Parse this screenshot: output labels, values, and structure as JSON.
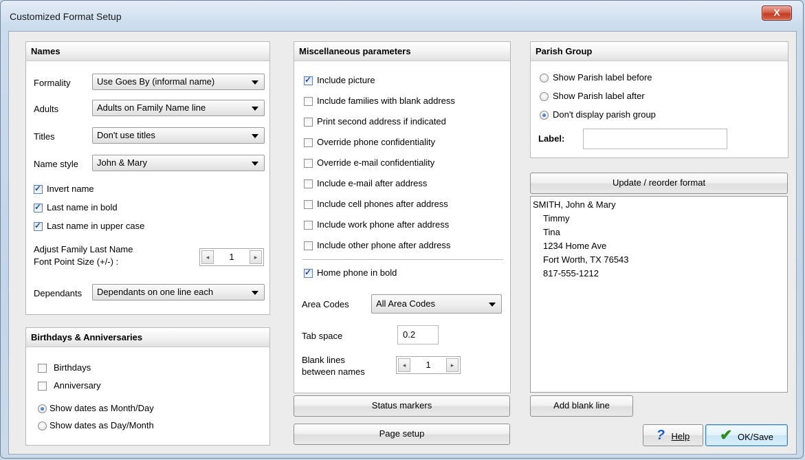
{
  "window": {
    "title": "Customized Format Setup",
    "close_glyph": "X"
  },
  "names": {
    "header": "Names",
    "formality_label": "Formality",
    "formality_value": "Use Goes By (informal name)",
    "adults_label": "Adults",
    "adults_value": "Adults on Family Name line",
    "titles_label": "Titles",
    "titles_value": "Don't use titles",
    "namestyle_label": "Name style",
    "namestyle_value": "John & Mary",
    "invert_name": "Invert name",
    "last_bold": "Last name in bold",
    "last_upper": "Last name in upper case",
    "adjust_line1": "Adjust Family Last Name",
    "adjust_line2": "Font Point Size (+/-) :",
    "adjust_value": "1",
    "dependants_label": "Dependants",
    "dependants_value": "Dependants on one line each"
  },
  "birthdays": {
    "header": "Birthdays & Anniversaries",
    "birthdays": "Birthdays",
    "anniversary": "Anniversary",
    "month_day": "Show dates as Month/Day",
    "day_month": "Show dates as Day/Month"
  },
  "misc": {
    "header": "Miscellaneous parameters",
    "options": [
      "Include picture",
      "Include families with blank address",
      "Print second address if indicated",
      "Override phone confidentiality",
      "Override e-mail confidentiality",
      "Include e-mail after address",
      "Include cell phones after address",
      "Include work phone after address",
      "Include other phone after address"
    ],
    "home_bold": "Home phone in bold",
    "area_codes_label": "Area Codes",
    "area_codes_value": "All Area Codes",
    "tab_space_label": "Tab space",
    "tab_space_value": "0.2",
    "blank_lines_1": "Blank lines",
    "blank_lines_2": "between names",
    "blank_lines_value": "1"
  },
  "parish": {
    "header": "Parish Group",
    "before": "Show Parish label before",
    "after": "Show Parish label after",
    "none": "Don't display parish group",
    "label_caption": "Label:",
    "label_value": ""
  },
  "format": {
    "update_button": "Update / reorder format",
    "preview_lines": [
      "SMITH, John & Mary",
      "Timmy",
      "Tina",
      "1234 Home Ave",
      "Fort Worth, TX 76543",
      "817-555-1212"
    ],
    "add_blank_button": "Add blank line"
  },
  "buttons": {
    "status_markers": "Status markers",
    "page_setup": "Page setup",
    "help": "Help",
    "ok_save": "OK/Save"
  },
  "icons": {
    "arrow_left": "◂",
    "arrow_right": "▸",
    "help_glyph": "?",
    "ok_glyph": "✔"
  }
}
